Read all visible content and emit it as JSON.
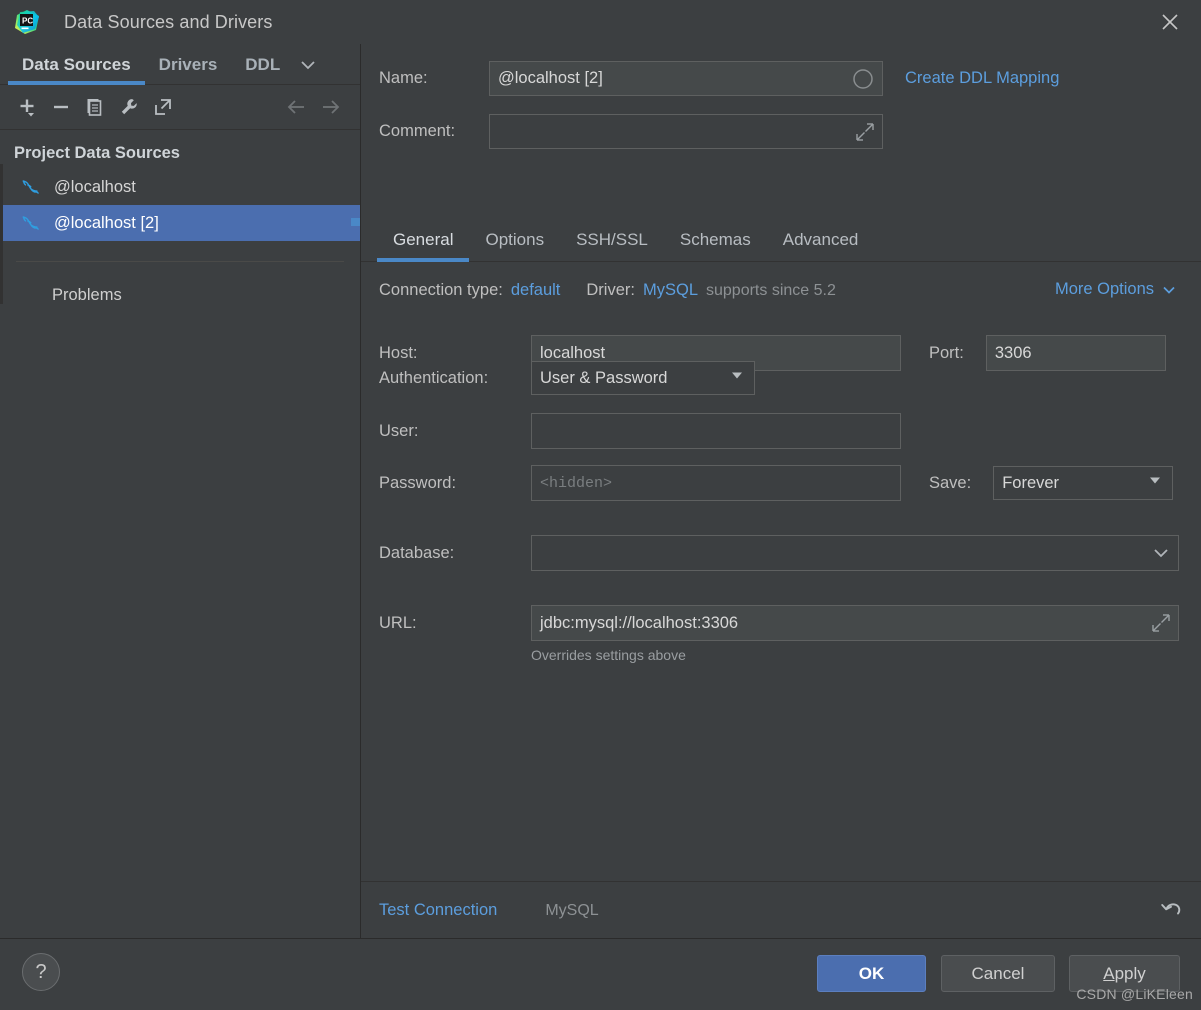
{
  "window": {
    "title": "Data Sources and Drivers",
    "app_icon": "pycharm-logo-icon",
    "close_icon": "close-icon"
  },
  "sidebar": {
    "tabs": [
      {
        "label": "Data Sources",
        "active": true
      },
      {
        "label": "Drivers",
        "active": false
      },
      {
        "label": "DDL",
        "active": false
      }
    ],
    "tabs_overflow_icon": "chevron-down-icon",
    "toolbar": [
      {
        "name": "add-data-source-button",
        "icon": "plus-icon"
      },
      {
        "name": "remove-data-source-button",
        "icon": "minus-icon"
      },
      {
        "name": "duplicate-data-source-button",
        "icon": "copy-icon"
      },
      {
        "name": "driver-properties-button",
        "icon": "wrench-icon"
      },
      {
        "name": "open-external-button",
        "icon": "external-link-icon"
      },
      {
        "name": "navigate-back-button",
        "icon": "arrow-left-icon"
      },
      {
        "name": "navigate-forward-button",
        "icon": "arrow-right-icon"
      }
    ],
    "group_title": "Project Data Sources",
    "items": [
      {
        "label": "@localhost",
        "icon": "mysql-dolphin-icon",
        "selected": false
      },
      {
        "label": "@localhost [2]",
        "icon": "mysql-dolphin-icon",
        "selected": true
      }
    ],
    "problems_label": "Problems"
  },
  "form": {
    "name_label": "Name:",
    "name_value": "@localhost [2]",
    "name_status_icon": "circle-icon",
    "create_ddl_mapping_label": "Create DDL Mapping",
    "comment_label": "Comment:",
    "comment_value": "",
    "comment_expand_icon": "expand-icon"
  },
  "tabs": [
    {
      "label": "General",
      "active": true
    },
    {
      "label": "Options",
      "active": false
    },
    {
      "label": "SSH/SSL",
      "active": false
    },
    {
      "label": "Schemas",
      "active": false
    },
    {
      "label": "Advanced",
      "active": false
    }
  ],
  "general": {
    "connection_type_label": "Connection type:",
    "connection_type_value": "default",
    "driver_label": "Driver:",
    "driver_value": "MySQL",
    "driver_note": "supports since 5.2",
    "more_options_label": "More Options",
    "more_options_icon": "chevron-down-icon",
    "host_label": "Host:",
    "host_value": "localhost",
    "port_label": "Port:",
    "port_value": "3306",
    "authentication_label": "Authentication:",
    "authentication_value": "User & Password",
    "user_label": "User:",
    "user_value": "",
    "password_label": "Password:",
    "password_placeholder": "<hidden>",
    "save_label": "Save:",
    "save_value": "Forever",
    "database_label": "Database:",
    "database_value": "",
    "url_label": "URL:",
    "url_value": "jdbc:mysql://localhost:3306",
    "url_expand_icon": "expand-icon",
    "url_hint": "Overrides settings above"
  },
  "panel_bottom": {
    "test_connection_label": "Test Connection",
    "driver_name_label": "MySQL",
    "reset_icon": "reset-icon"
  },
  "footer": {
    "help_label": "?",
    "ok_label": "OK",
    "cancel_label": "Cancel",
    "apply_label_underlined": "A",
    "apply_label_rest": "pply",
    "watermark": "CSDN @LiKEleen"
  },
  "colors": {
    "background": "#3c3f41",
    "selection_blue": "#4b6eaf",
    "accent_blue": "#4a88c7",
    "link_blue": "#5c9ede",
    "field_bg": "#45494a",
    "border": "#5e6060"
  }
}
